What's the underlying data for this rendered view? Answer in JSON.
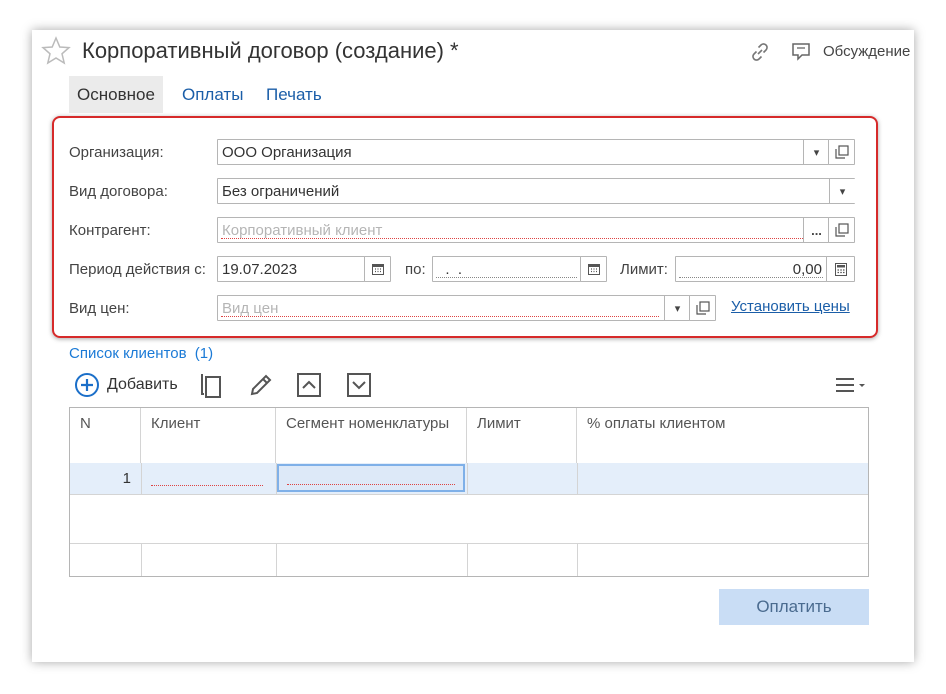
{
  "window": {
    "title": "Корпоративный договор (создание) *",
    "discussion_label": "Обсуждение"
  },
  "tabs": [
    {
      "label": "Основное",
      "active": true
    },
    {
      "label": "Оплаты",
      "active": false
    },
    {
      "label": "Печать",
      "active": false
    }
  ],
  "form": {
    "organization": {
      "label": "Организация:",
      "value": "ООО Организация"
    },
    "contract_type": {
      "label": "Вид договора:",
      "value": "Без ограничений"
    },
    "counterparty": {
      "label": "Контрагент:",
      "value": "",
      "placeholder": "Корпоративный клиент"
    },
    "period": {
      "label_from": "Период действия с:",
      "from": "19.07.2023",
      "label_to": "по:",
      "to": "  .  .",
      "label_limit": "Лимит:",
      "limit": "0,00"
    },
    "price_type": {
      "label": "Вид цен:",
      "value": "",
      "placeholder": "Вид цен",
      "set_prices_link": "Установить цены"
    }
  },
  "clients": {
    "title": "Список клиентов",
    "count": "(1)",
    "add_label": "Добавить",
    "columns": [
      "N",
      "Клиент",
      "Сегмент номенклатуры",
      "Лимит",
      "% оплаты клиентом"
    ],
    "rows": [
      {
        "n": "1",
        "client": "",
        "segment": "",
        "limit": "",
        "percent": ""
      }
    ]
  },
  "pay_button": "Оплатить",
  "colors": {
    "accent_link": "#1b5ea8",
    "highlight_border": "#d62a2a",
    "selected_row": "#e4eefa",
    "pay_button_bg": "#c9ddf5"
  },
  "icons": [
    "star-icon",
    "link-icon",
    "discussion-icon",
    "dropdown-arrow-icon",
    "open-form-icon",
    "ellipsis-icon",
    "calendar-icon",
    "calculator-icon",
    "add-circle-icon",
    "copy-icon",
    "edit-icon",
    "move-up-icon",
    "move-down-icon",
    "more-menu-icon"
  ]
}
